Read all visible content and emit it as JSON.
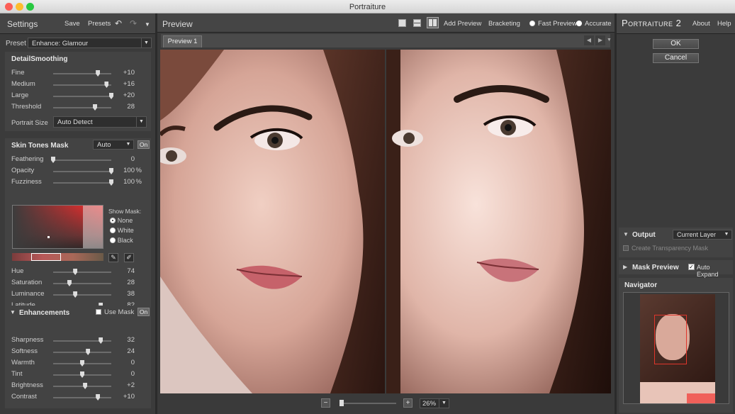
{
  "window": {
    "title": "Portraiture"
  },
  "left": {
    "header": {
      "title": "Settings",
      "save": "Save",
      "presets": "Presets"
    },
    "preset": {
      "label": "Preset",
      "value": "Enhance: Glamour"
    },
    "detail": {
      "title": "DetailSmoothing",
      "sliders": [
        {
          "label": "Fine",
          "value": "+10",
          "pos": 0.77
        },
        {
          "label": "Medium",
          "value": "+16",
          "pos": 0.92
        },
        {
          "label": "Large",
          "value": "+20",
          "pos": 1.0
        },
        {
          "label": "Threshold",
          "value": "28",
          "pos": 0.72
        }
      ],
      "portrait_size_label": "Portrait Size",
      "portrait_size_value": "Auto Detect"
    },
    "skin": {
      "title": "Skin Tones Mask",
      "mode": "Auto",
      "on": "On",
      "sliders": [
        {
          "label": "Feathering",
          "value": "0",
          "unit": "",
          "pos": 0.0
        },
        {
          "label": "Opacity",
          "value": "100",
          "unit": "%",
          "pos": 1.0
        },
        {
          "label": "Fuzziness",
          "value": "100",
          "unit": "%",
          "pos": 1.0
        }
      ],
      "show_mask": "Show Mask:",
      "mask_options": [
        "None",
        "White",
        "Black"
      ],
      "mask_selected": "None",
      "sliders2": [
        {
          "label": "Hue",
          "value": "74",
          "pos": 0.38
        },
        {
          "label": "Saturation",
          "value": "28",
          "pos": 0.28
        },
        {
          "label": "Luminance",
          "value": "38",
          "pos": 0.38
        },
        {
          "label": "Latitude",
          "value": "82",
          "pos": 0.82
        }
      ]
    },
    "enh": {
      "title": "Enhancements",
      "use_mask": "Use Mask",
      "on": "On",
      "sliders": [
        {
          "label": "Sharpness",
          "value": "32",
          "pos": 0.82
        },
        {
          "label": "Softness",
          "value": "24",
          "pos": 0.6
        },
        {
          "label": "Warmth",
          "value": "0",
          "pos": 0.5
        },
        {
          "label": "Tint",
          "value": "0",
          "pos": 0.5
        },
        {
          "label": "Brightness",
          "value": "+2",
          "pos": 0.55
        },
        {
          "label": "Contrast",
          "value": "+10",
          "pos": 0.77
        }
      ]
    }
  },
  "center": {
    "title": "Preview",
    "add_preview": "Add Preview",
    "bracketing": "Bracketing",
    "fast_preview": "Fast Preview",
    "accurate": "Accurate",
    "tab": "Preview 1",
    "zoom": "26%",
    "minus": "−",
    "plus": "+"
  },
  "right": {
    "brand": "Portraiture 2",
    "about": "About",
    "help": "Help",
    "ok": "OK",
    "cancel": "Cancel",
    "output": "Output",
    "output_value": "Current Layer",
    "transparency": "Create Transparency Mask",
    "mask_preview": "Mask Preview",
    "auto_expand": "Auto Expand",
    "navigator": "Navigator"
  },
  "colors": {
    "accent": "#e0352b",
    "panel": "#3b3b3b"
  }
}
